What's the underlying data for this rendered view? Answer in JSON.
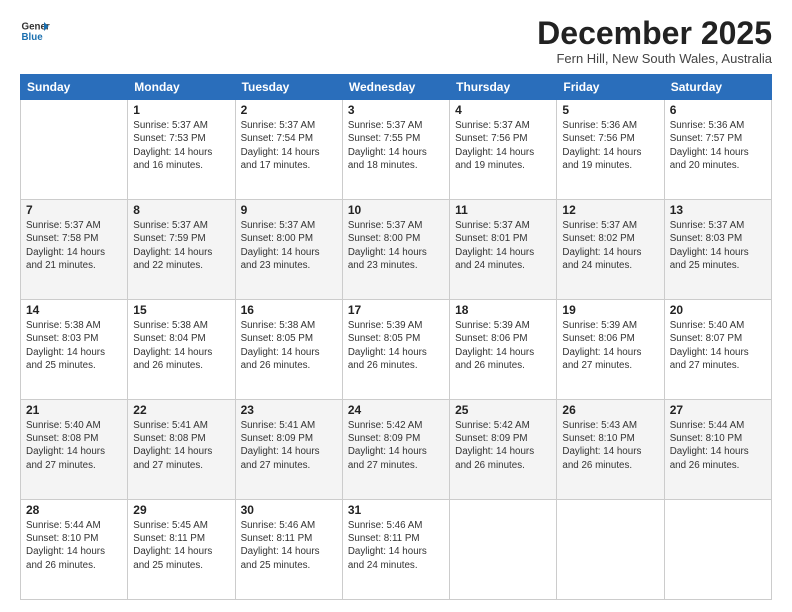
{
  "header": {
    "logo_line1": "General",
    "logo_line2": "Blue",
    "month_title": "December 2025",
    "location": "Fern Hill, New South Wales, Australia"
  },
  "days_of_week": [
    "Sunday",
    "Monday",
    "Tuesday",
    "Wednesday",
    "Thursday",
    "Friday",
    "Saturday"
  ],
  "weeks": [
    [
      {
        "day": "",
        "sunrise": "",
        "sunset": "",
        "daylight": ""
      },
      {
        "day": "1",
        "sunrise": "5:37 AM",
        "sunset": "7:53 PM",
        "daylight": "14 hours and 16 minutes."
      },
      {
        "day": "2",
        "sunrise": "5:37 AM",
        "sunset": "7:54 PM",
        "daylight": "14 hours and 17 minutes."
      },
      {
        "day": "3",
        "sunrise": "5:37 AM",
        "sunset": "7:55 PM",
        "daylight": "14 hours and 18 minutes."
      },
      {
        "day": "4",
        "sunrise": "5:37 AM",
        "sunset": "7:56 PM",
        "daylight": "14 hours and 19 minutes."
      },
      {
        "day": "5",
        "sunrise": "5:36 AM",
        "sunset": "7:56 PM",
        "daylight": "14 hours and 19 minutes."
      },
      {
        "day": "6",
        "sunrise": "5:36 AM",
        "sunset": "7:57 PM",
        "daylight": "14 hours and 20 minutes."
      }
    ],
    [
      {
        "day": "7",
        "sunrise": "5:37 AM",
        "sunset": "7:58 PM",
        "daylight": "14 hours and 21 minutes."
      },
      {
        "day": "8",
        "sunrise": "5:37 AM",
        "sunset": "7:59 PM",
        "daylight": "14 hours and 22 minutes."
      },
      {
        "day": "9",
        "sunrise": "5:37 AM",
        "sunset": "8:00 PM",
        "daylight": "14 hours and 23 minutes."
      },
      {
        "day": "10",
        "sunrise": "5:37 AM",
        "sunset": "8:00 PM",
        "daylight": "14 hours and 23 minutes."
      },
      {
        "day": "11",
        "sunrise": "5:37 AM",
        "sunset": "8:01 PM",
        "daylight": "14 hours and 24 minutes."
      },
      {
        "day": "12",
        "sunrise": "5:37 AM",
        "sunset": "8:02 PM",
        "daylight": "14 hours and 24 minutes."
      },
      {
        "day": "13",
        "sunrise": "5:37 AM",
        "sunset": "8:03 PM",
        "daylight": "14 hours and 25 minutes."
      }
    ],
    [
      {
        "day": "14",
        "sunrise": "5:38 AM",
        "sunset": "8:03 PM",
        "daylight": "14 hours and 25 minutes."
      },
      {
        "day": "15",
        "sunrise": "5:38 AM",
        "sunset": "8:04 PM",
        "daylight": "14 hours and 26 minutes."
      },
      {
        "day": "16",
        "sunrise": "5:38 AM",
        "sunset": "8:05 PM",
        "daylight": "14 hours and 26 minutes."
      },
      {
        "day": "17",
        "sunrise": "5:39 AM",
        "sunset": "8:05 PM",
        "daylight": "14 hours and 26 minutes."
      },
      {
        "day": "18",
        "sunrise": "5:39 AM",
        "sunset": "8:06 PM",
        "daylight": "14 hours and 26 minutes."
      },
      {
        "day": "19",
        "sunrise": "5:39 AM",
        "sunset": "8:06 PM",
        "daylight": "14 hours and 27 minutes."
      },
      {
        "day": "20",
        "sunrise": "5:40 AM",
        "sunset": "8:07 PM",
        "daylight": "14 hours and 27 minutes."
      }
    ],
    [
      {
        "day": "21",
        "sunrise": "5:40 AM",
        "sunset": "8:08 PM",
        "daylight": "14 hours and 27 minutes."
      },
      {
        "day": "22",
        "sunrise": "5:41 AM",
        "sunset": "8:08 PM",
        "daylight": "14 hours and 27 minutes."
      },
      {
        "day": "23",
        "sunrise": "5:41 AM",
        "sunset": "8:09 PM",
        "daylight": "14 hours and 27 minutes."
      },
      {
        "day": "24",
        "sunrise": "5:42 AM",
        "sunset": "8:09 PM",
        "daylight": "14 hours and 27 minutes."
      },
      {
        "day": "25",
        "sunrise": "5:42 AM",
        "sunset": "8:09 PM",
        "daylight": "14 hours and 26 minutes."
      },
      {
        "day": "26",
        "sunrise": "5:43 AM",
        "sunset": "8:10 PM",
        "daylight": "14 hours and 26 minutes."
      },
      {
        "day": "27",
        "sunrise": "5:44 AM",
        "sunset": "8:10 PM",
        "daylight": "14 hours and 26 minutes."
      }
    ],
    [
      {
        "day": "28",
        "sunrise": "5:44 AM",
        "sunset": "8:10 PM",
        "daylight": "14 hours and 26 minutes."
      },
      {
        "day": "29",
        "sunrise": "5:45 AM",
        "sunset": "8:11 PM",
        "daylight": "14 hours and 25 minutes."
      },
      {
        "day": "30",
        "sunrise": "5:46 AM",
        "sunset": "8:11 PM",
        "daylight": "14 hours and 25 minutes."
      },
      {
        "day": "31",
        "sunrise": "5:46 AM",
        "sunset": "8:11 PM",
        "daylight": "14 hours and 24 minutes."
      },
      {
        "day": "",
        "sunrise": "",
        "sunset": "",
        "daylight": ""
      },
      {
        "day": "",
        "sunrise": "",
        "sunset": "",
        "daylight": ""
      },
      {
        "day": "",
        "sunrise": "",
        "sunset": "",
        "daylight": ""
      }
    ]
  ]
}
